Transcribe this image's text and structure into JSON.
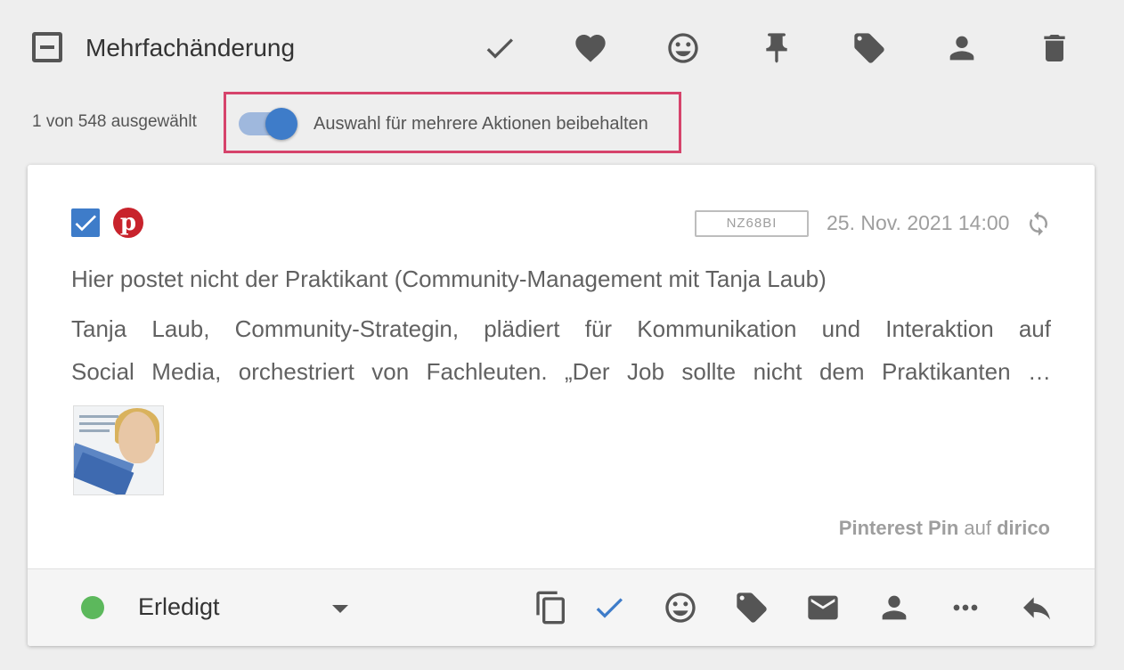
{
  "header": {
    "title": "Mehrfachänderung",
    "icons": [
      "check-icon",
      "heart-icon",
      "smiley-icon",
      "pin-icon",
      "tag-icon",
      "person-icon",
      "trash-icon"
    ]
  },
  "selection": {
    "count_text": "1 von 548 ausgewählt",
    "keep_label": "Auswahl für mehrere Aktionen beibehalten",
    "keep_enabled": true
  },
  "post": {
    "selected": true,
    "network_icon": "pinterest-icon",
    "code": "NZ68BI",
    "timestamp": "25. Nov. 2021 14:00",
    "title": "Hier postet nicht der Praktikant (Community-Management mit Tanja Laub)",
    "body_lines": [
      "Tanja Laub, Community-Strategin, plädiert für Kommunikation und Interaktion auf",
      "Social Media, orchestriert von Fachleuten. „Der Job sollte nicht dem Praktikanten …"
    ],
    "source_prefix": "Pinterest Pin",
    "source_middle": " auf ",
    "source_account": "dirico"
  },
  "footer": {
    "status_label": "Erledigt",
    "status_color": "#5cb85c",
    "accent_color": "#3e7cc9",
    "icons": [
      "copy-icon",
      "check-icon",
      "smiley-icon",
      "tag-icon",
      "mail-icon",
      "person-icon",
      "more-icon",
      "reply-icon"
    ]
  }
}
